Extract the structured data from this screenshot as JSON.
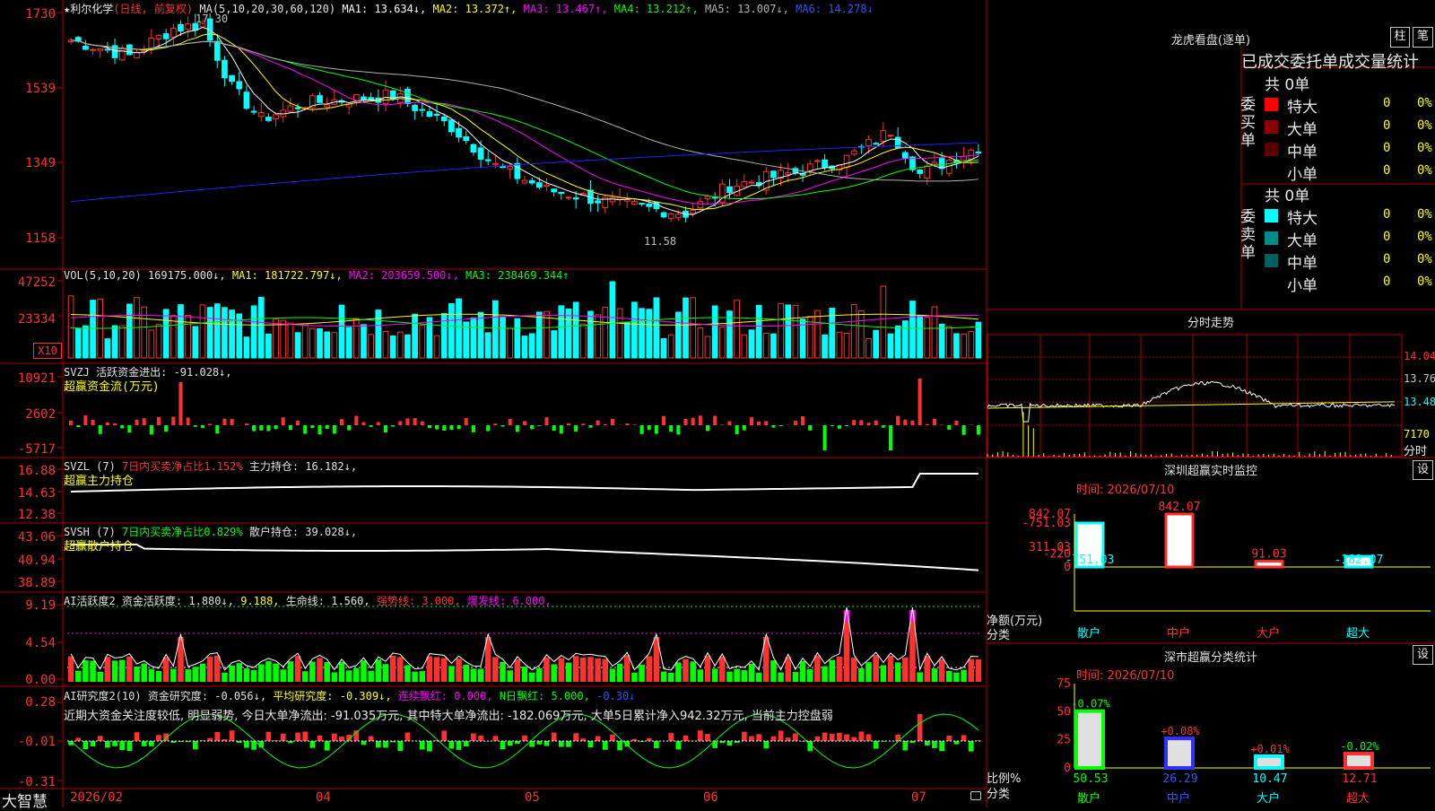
{
  "main_chart": {
    "title": "★利尔化学",
    "period": "(日线, 前复权)",
    "ma_header": "MA(5,10,20,30,60,120)",
    "ma1": "MA1: 13.634↓,",
    "ma2": "MA2: 13.372↑,",
    "ma3": "MA3: 13.467↑,",
    "ma4": "MA4: 13.212↑,",
    "ma5": "MA5: 13.007↓,",
    "ma6": "MA6: 14.278↓",
    "y_labels": [
      "1730",
      "1539",
      "1349",
      "1158"
    ],
    "high_note": "17.30",
    "low_note": "11.58"
  },
  "vol_panel": {
    "header": "VOL(5,10,20)",
    "value": "169175.000↓,",
    "ma1": "MA1: 181722.797↓,",
    "ma2": "MA2: 203659.500↓,",
    "ma3": "MA3: 238469.344↑",
    "y_labels": [
      "47252",
      "23334"
    ],
    "unit": "X10"
  },
  "svzj_panel": {
    "header": "SVZJ  活跃资金进出: -91.028↓,",
    "subtitle": "超赢资金流(万元)",
    "y_labels": [
      "10921",
      "2602",
      "-5717"
    ]
  },
  "svzl_panel": {
    "header": "SVZL (7)",
    "ratio": "7日内买卖净占比1.152%",
    "hold": "主力持仓: 16.182↓,",
    "subtitle": "超赢主力持仓",
    "y_labels": [
      "16.88",
      "14.63",
      "12.38"
    ]
  },
  "svsh_panel": {
    "header": "SVSH (7)",
    "ratio": "7日内买卖净占比0.829%",
    "hold": "散户持仓: 39.028↓,",
    "subtitle": "超赢散户持仓",
    "y_labels": [
      "43.06",
      "40.94",
      "38.89"
    ]
  },
  "ai_active_panel": {
    "header": "AI活跃度2",
    "active": "资金活跃度: 1.880↓,",
    "val2": "9.188,",
    "life": "生命线: 1.560,",
    "strong": "强势线: 3.000,",
    "burst": "爆发线: 6.000,",
    "y_labels": [
      "9.19",
      "4.54",
      "0.00"
    ]
  },
  "ai_research_panel": {
    "header": "AI研究度2(10)",
    "research": "资金研究度: -0.056↓,",
    "avg": "平均研究度: -0.309↓,",
    "red": "连续飘红: 0.000,",
    "nred": "N日飘红: 5.000,",
    "last": "-0.30↓",
    "comment": "近期大资金关注度较低, 明显弱势, 今日大单净流出: -91.035万元, 其中特大单净流出: -182.069万元, 大单5日累计净入942.32万元, 当前主力控盘弱",
    "y_labels": [
      "0.28",
      "-0.01",
      "-0.31"
    ]
  },
  "x_axis": {
    "labels": [
      "2026/02",
      "04",
      "05",
      "06",
      "07"
    ]
  },
  "footer": {
    "brand": "大智慧"
  },
  "lhb": {
    "title": "龙虎看盘(逐单)",
    "btn_zhu": "柱",
    "btn_bi": "笔",
    "subtitle": "已成交委托单成交量统计",
    "buy_label": "委买单",
    "sell_label": "委卖单",
    "buy_total": "共 0单",
    "sell_total": "共 0单",
    "buy_rows": [
      {
        "name": "特大",
        "count": "0",
        "pct": "0%",
        "color": "#ff0000"
      },
      {
        "name": "大单",
        "count": "0",
        "pct": "0%",
        "color": "#8b0000"
      },
      {
        "name": "中单",
        "count": "0",
        "pct": "0%",
        "color": "#5a0000"
      },
      {
        "name": "小单",
        "count": "0",
        "pct": "0%",
        "color": ""
      }
    ],
    "sell_rows": [
      {
        "name": "特大",
        "count": "0",
        "pct": "0%",
        "color": "#00ffff"
      },
      {
        "name": "大单",
        "count": "0",
        "pct": "0%",
        "color": "#008b8b"
      },
      {
        "name": "中单",
        "count": "0",
        "pct": "0%",
        "color": "#006060"
      },
      {
        "name": "小单",
        "count": "0",
        "pct": "0%",
        "color": ""
      }
    ]
  },
  "intraday": {
    "title": "分时走势",
    "prices": [
      "14.04",
      "13.76",
      "13.48"
    ],
    "vol_label": "7170",
    "vol_unit": "分时"
  },
  "monitor": {
    "title": "深圳超赢实时监控",
    "settings": "设",
    "time": "时间: 2026/07/10",
    "y_labels": [
      "842.07",
      "311.03",
      "0",
      "-220",
      "-751.03"
    ],
    "ylabel": "净额(万元)",
    "xlabel": "分类",
    "categories": [
      "散户",
      "中户",
      "大户",
      "超大"
    ],
    "values": [
      -751.03,
      842.07,
      91.03,
      -182.07
    ],
    "value_labels": [
      "-751.03",
      "842.07",
      "91.03",
      "-182.07"
    ]
  },
  "classify": {
    "title": "深市超赢分类统计",
    "settings": "设",
    "time": "时间: 2026/07/10",
    "y_labels": [
      "75",
      "50",
      "25",
      "0"
    ],
    "ylabel": "比例%",
    "xlabel": "分类",
    "categories": [
      "散户",
      "中户",
      "大户",
      "超大"
    ],
    "values": [
      50.53,
      26.29,
      10.47,
      12.71
    ],
    "value_labels": [
      "50.53",
      "26.29",
      "10.47",
      "12.71"
    ],
    "changes": [
      "-0.07%",
      "+0.08%",
      "+0.01%",
      "-0.02%"
    ]
  },
  "colors": {
    "up": "#ff3030",
    "down": "#00ffff",
    "grid": "#8b0000",
    "ma1": "#ffffff",
    "ma2": "#ffff00",
    "ma3": "#ff00ff",
    "ma4": "#00ff00",
    "ma5": "#b0b0b0",
    "ma6": "#2020ff"
  }
}
